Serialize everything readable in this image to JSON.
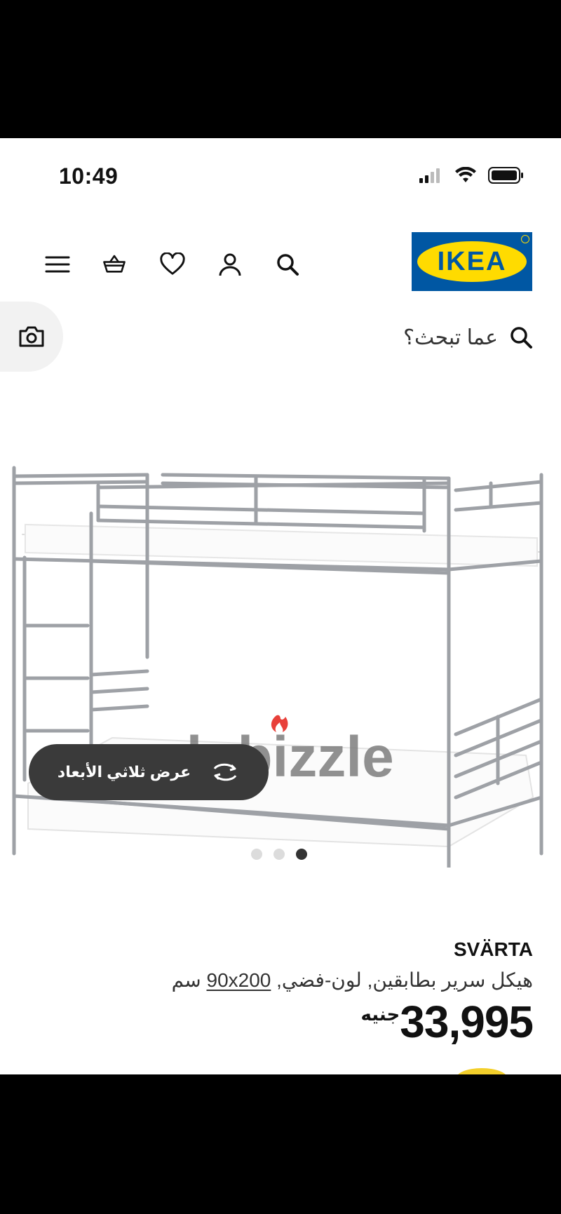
{
  "status_bar": {
    "time": "10:49"
  },
  "header": {
    "logo_text": "IKEA",
    "icons": [
      "menu-icon",
      "basket-icon",
      "heart-icon",
      "user-icon",
      "search-icon"
    ]
  },
  "search": {
    "placeholder": "عما تبحث؟"
  },
  "gallery": {
    "watermark": "dubizzle",
    "view_3d_label": "عرض ثلاثي الأبعاد",
    "dots_total": 3,
    "active_dot": 3
  },
  "product": {
    "name": "SVÄRTA",
    "description": "هيكل سرير بطابقين, لون-فضي,",
    "size": "90x200",
    "size_unit": "سم",
    "price": "33,995",
    "currency": "جنيه"
  },
  "colors": {
    "ikea_blue": "#0057a3",
    "ikea_yellow": "#ffdb00",
    "button_dark": "#3a3a3a",
    "dubizzle_red": "#e8403a"
  }
}
